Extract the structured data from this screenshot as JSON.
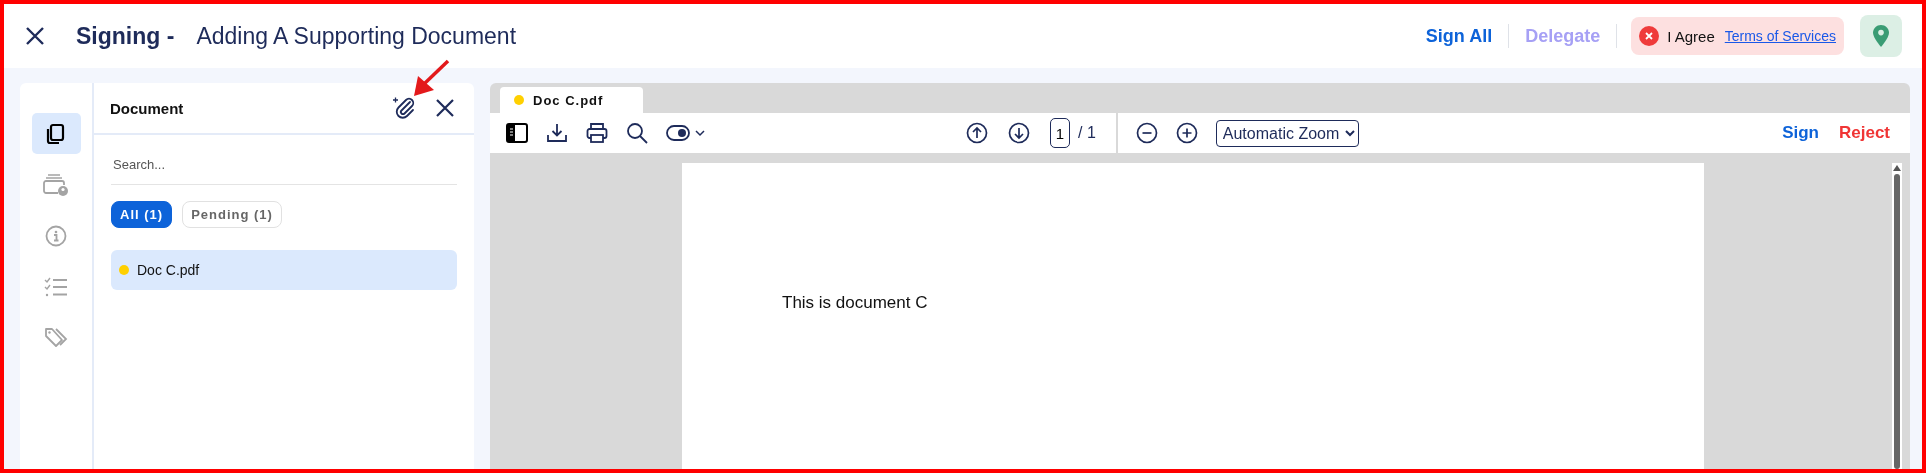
{
  "header": {
    "title": "Signing -",
    "subtitle": "Adding A Supporting Document",
    "actions": [
      {
        "label": "Sign All",
        "disabled": false
      },
      {
        "label": "Delegate",
        "disabled": true
      }
    ],
    "agreement": {
      "checked": false,
      "label": "I Agree",
      "link": "Terms of Services"
    }
  },
  "rail": [
    {
      "kind": "documents",
      "selected": true
    },
    {
      "kind": "signers",
      "selected": false
    },
    {
      "kind": "info",
      "selected": false
    },
    {
      "kind": "checklist",
      "selected": false
    },
    {
      "kind": "tags",
      "selected": false
    }
  ],
  "panel": {
    "title": "Document",
    "search": {
      "placeholder": "Search..."
    },
    "filters": [
      {
        "label": "All (1)",
        "selected": true
      },
      {
        "label": "Pending (1)",
        "selected": false
      }
    ],
    "documents": [
      {
        "name": "Doc C.pdf",
        "color": "#ffd000",
        "selected": true
      }
    ]
  },
  "viewer": {
    "tabs": [
      {
        "label": "Doc C.pdf",
        "color": "#ffd000",
        "selected": true
      }
    ],
    "page_number": "1",
    "page_count": "/ 1",
    "zoom": "Automatic Zoom",
    "actions": [
      {
        "label": "Sign",
        "kind": "sign"
      },
      {
        "label": "Reject",
        "kind": "reject"
      }
    ],
    "page_text": "This is document C"
  }
}
